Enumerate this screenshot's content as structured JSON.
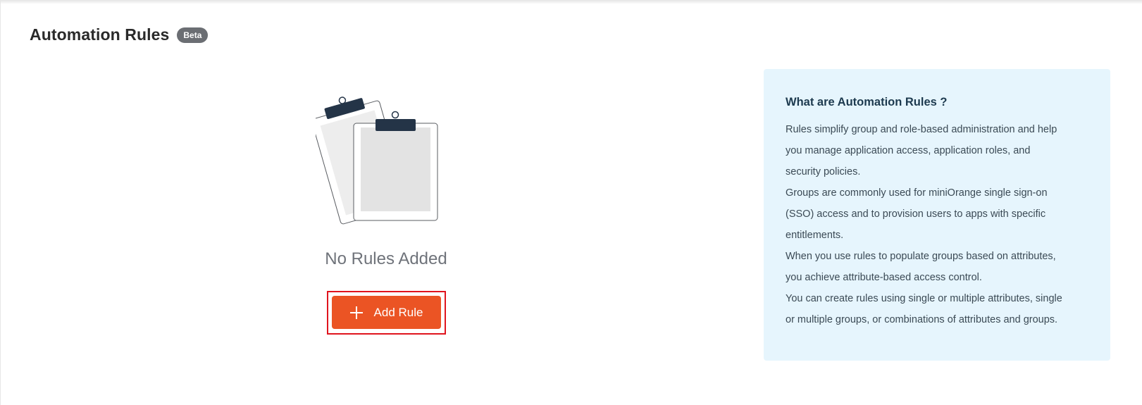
{
  "header": {
    "title": "Automation Rules",
    "badge": "Beta"
  },
  "empty_state": {
    "illustration": "clipboards-illustration",
    "title": "No Rules Added",
    "button_label": "Add Rule",
    "button_icon": "plus-icon",
    "button_color": "#eb5424"
  },
  "info_panel": {
    "title": "What are Automation Rules ?",
    "lines": [
      "Rules simplify group and role-based administration and help",
      "you manage application access, application roles, and",
      "security policies.",
      "Groups are commonly used for miniOrange single sign-on",
      "(SSO) access and to provision users to apps with specific",
      "entitlements.",
      "When you use rules to populate groups based on attributes,",
      "you achieve attribute-based access control.",
      "You can create rules using single or multiple attributes, single",
      "or multiple groups, or combinations of attributes and groups."
    ],
    "background": "#e6f5fd"
  }
}
